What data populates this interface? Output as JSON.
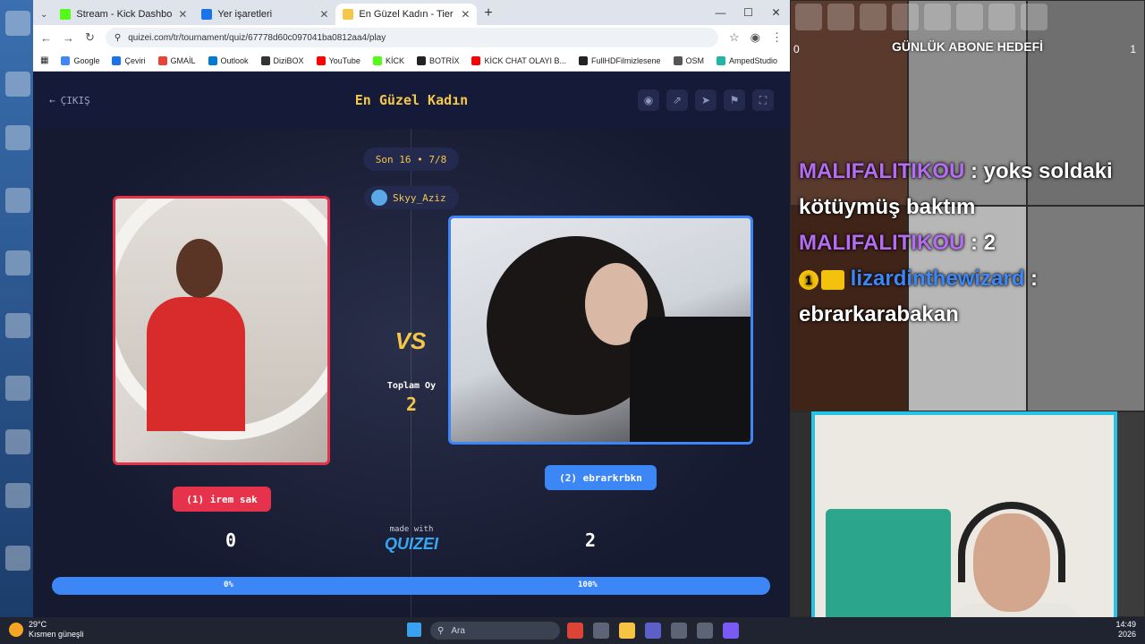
{
  "browser": {
    "tabs": [
      {
        "title": "Stream - Kick Dashboard",
        "color": "#53fc18",
        "active": false
      },
      {
        "title": "Yer işaretleri",
        "color": "#1a73e8",
        "active": false
      },
      {
        "title": "En Güzel Kadın - Tier List, Kör S",
        "color": "#f4c74b",
        "active": true
      }
    ],
    "new_tab": "+",
    "window_controls": {
      "minimize": "—",
      "maximize": "☐",
      "close": "✕"
    },
    "nav": {
      "back": "←",
      "forward": "→",
      "reload": "↻"
    },
    "url": "quizei.com/tr/tournament/quiz/67778d60c097041ba0812aa4/play",
    "bookmarks": [
      {
        "label": "Google",
        "color": "#4285f4"
      },
      {
        "label": "Çeviri",
        "color": "#1a73e8"
      },
      {
        "label": "GMAİL",
        "color": "#ea4335"
      },
      {
        "label": "Outlook",
        "color": "#0078d4"
      },
      {
        "label": "DiziBOX",
        "color": "#333333"
      },
      {
        "label": "YouTube",
        "color": "#ff0000"
      },
      {
        "label": "KİCK",
        "color": "#53fc18"
      },
      {
        "label": "BOTRİX",
        "color": "#222222"
      },
      {
        "label": "KİCK CHAT OLAYI B...",
        "color": "#ff0000"
      },
      {
        "label": "FullHDFilmizlesene",
        "color": "#222222"
      },
      {
        "label": "OSM",
        "color": "#555555"
      },
      {
        "label": "AmpedStudio",
        "color": "#1fb6a6"
      }
    ],
    "bookmarks_more": "»"
  },
  "quiz": {
    "exit_label": "ÇIKIŞ",
    "title": "En Güzel Kadın",
    "round_label": "Son 16 • 7/8",
    "username": "Skyy_Aziz",
    "vs_label": "VS",
    "total_votes_label": "Toplam Oy",
    "total_votes": "2",
    "left": {
      "name": "(1) irem sak",
      "score": "0",
      "percent_label": "0%",
      "percent": 0
    },
    "right": {
      "name": "(2) ebrarkrbkn",
      "score": "2",
      "percent_label": "100%",
      "percent": 100
    },
    "made_with": "made with",
    "brand": "QUIZEI",
    "colors": {
      "left": "#e6334b",
      "right": "#3d86f5",
      "accent": "#f4c74b"
    }
  },
  "overlay": {
    "goal_title": "GÜNLÜK ABONE HEDEFİ",
    "goal_current": "0",
    "goal_target": "1",
    "chat": [
      {
        "user": "MALIFALITIKOU",
        "message": "yoks soldaki kötüymüş baktım",
        "color": "#b46cf0"
      },
      {
        "user": "MALIFALITIKOU",
        "message": "2",
        "color": "#b46cf0"
      },
      {
        "user": "lizardinthewizard",
        "message": "ebrarkarabakan",
        "color": "#3d86f5",
        "badge": "1"
      }
    ]
  },
  "taskbar": {
    "temperature": "29°C",
    "weather": "Kısmen güneşli",
    "search_placeholder": "Ara",
    "time": "14:49",
    "date": "2026"
  }
}
